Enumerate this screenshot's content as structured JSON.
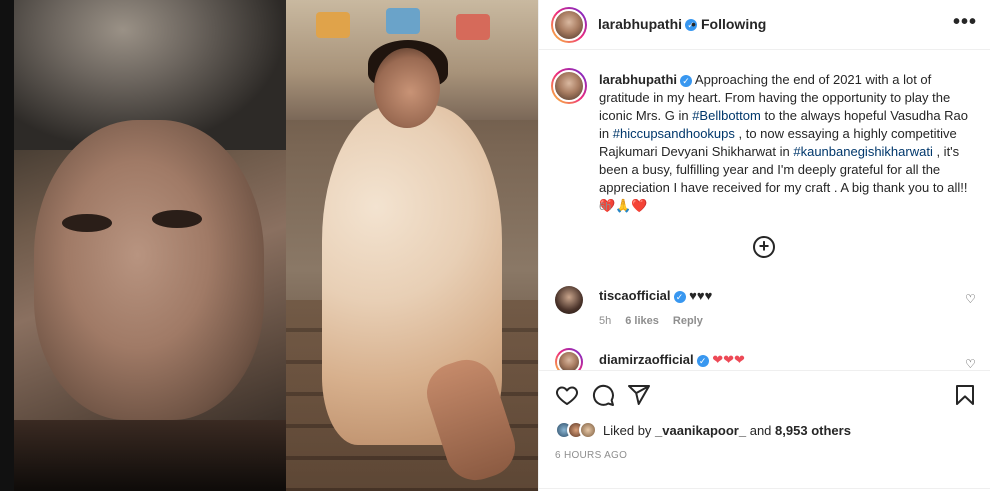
{
  "post": {
    "username": "larabhupathi",
    "follow_status": "Following",
    "separator": "•",
    "more_label": "•••"
  },
  "caption": {
    "username": "larabhupathi",
    "text_1": "Approaching the end of 2021 with a lot of gratitude in my heart. From having the opportunity to play the iconic Mrs. G in ",
    "tag_1": "#Bellbottom",
    "text_2": " to the always hopeful Vasudha Rao in ",
    "tag_2": "#hiccupsandhookups",
    "text_3": " , to now essaying a highly competitive Rajkumari Devyani Shikharwat in ",
    "tag_3": "#kaunbanegishikharwati",
    "text_4": " , it's been a busy, fulfilling year and I'm deeply grateful for all the appreciation I have received for my craft . A big thank you to all!! ",
    "emoji": "❤️🙏❤️",
    "time": "6h"
  },
  "load_more_icon": "plus-circle-icon",
  "comments": [
    {
      "username": "tiscaofficial",
      "text": "♥♥♥",
      "time": "5h",
      "likes": "6 likes",
      "reply": "Reply"
    },
    {
      "username": "diamirzaofficial",
      "text": "❤❤❤"
    }
  ],
  "actions": {
    "icons": [
      "heart-icon",
      "comment-icon",
      "share-icon",
      "bookmark-icon"
    ]
  },
  "likes": {
    "prefix": "Liked by",
    "user": "_vaanikapoor_",
    "and": "and",
    "count": "8,953 others"
  },
  "posted_ago": "6 HOURS AGO",
  "colors": {
    "verified": "#3897f0",
    "hashtag": "#00376b",
    "heart_red": "#ed4956",
    "muted": "#8e8e8e"
  }
}
